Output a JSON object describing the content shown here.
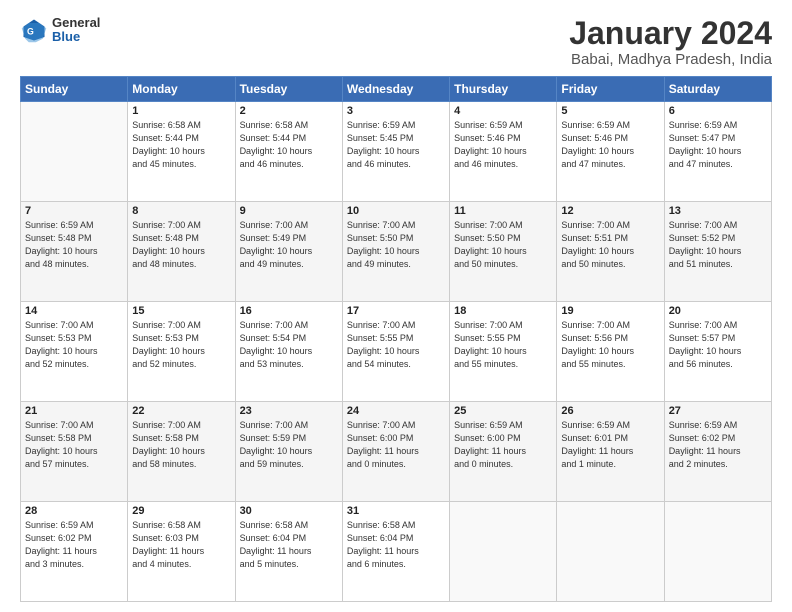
{
  "logo": {
    "general": "General",
    "blue": "Blue"
  },
  "title": "January 2024",
  "subtitle": "Babai, Madhya Pradesh, India",
  "headers": [
    "Sunday",
    "Monday",
    "Tuesday",
    "Wednesday",
    "Thursday",
    "Friday",
    "Saturday"
  ],
  "weeks": [
    [
      {
        "day": "",
        "info": ""
      },
      {
        "day": "1",
        "info": "Sunrise: 6:58 AM\nSunset: 5:44 PM\nDaylight: 10 hours\nand 45 minutes."
      },
      {
        "day": "2",
        "info": "Sunrise: 6:58 AM\nSunset: 5:44 PM\nDaylight: 10 hours\nand 46 minutes."
      },
      {
        "day": "3",
        "info": "Sunrise: 6:59 AM\nSunset: 5:45 PM\nDaylight: 10 hours\nand 46 minutes."
      },
      {
        "day": "4",
        "info": "Sunrise: 6:59 AM\nSunset: 5:46 PM\nDaylight: 10 hours\nand 46 minutes."
      },
      {
        "day": "5",
        "info": "Sunrise: 6:59 AM\nSunset: 5:46 PM\nDaylight: 10 hours\nand 47 minutes."
      },
      {
        "day": "6",
        "info": "Sunrise: 6:59 AM\nSunset: 5:47 PM\nDaylight: 10 hours\nand 47 minutes."
      }
    ],
    [
      {
        "day": "7",
        "info": "Sunrise: 6:59 AM\nSunset: 5:48 PM\nDaylight: 10 hours\nand 48 minutes."
      },
      {
        "day": "8",
        "info": "Sunrise: 7:00 AM\nSunset: 5:48 PM\nDaylight: 10 hours\nand 48 minutes."
      },
      {
        "day": "9",
        "info": "Sunrise: 7:00 AM\nSunset: 5:49 PM\nDaylight: 10 hours\nand 49 minutes."
      },
      {
        "day": "10",
        "info": "Sunrise: 7:00 AM\nSunset: 5:50 PM\nDaylight: 10 hours\nand 49 minutes."
      },
      {
        "day": "11",
        "info": "Sunrise: 7:00 AM\nSunset: 5:50 PM\nDaylight: 10 hours\nand 50 minutes."
      },
      {
        "day": "12",
        "info": "Sunrise: 7:00 AM\nSunset: 5:51 PM\nDaylight: 10 hours\nand 50 minutes."
      },
      {
        "day": "13",
        "info": "Sunrise: 7:00 AM\nSunset: 5:52 PM\nDaylight: 10 hours\nand 51 minutes."
      }
    ],
    [
      {
        "day": "14",
        "info": "Sunrise: 7:00 AM\nSunset: 5:53 PM\nDaylight: 10 hours\nand 52 minutes."
      },
      {
        "day": "15",
        "info": "Sunrise: 7:00 AM\nSunset: 5:53 PM\nDaylight: 10 hours\nand 52 minutes."
      },
      {
        "day": "16",
        "info": "Sunrise: 7:00 AM\nSunset: 5:54 PM\nDaylight: 10 hours\nand 53 minutes."
      },
      {
        "day": "17",
        "info": "Sunrise: 7:00 AM\nSunset: 5:55 PM\nDaylight: 10 hours\nand 54 minutes."
      },
      {
        "day": "18",
        "info": "Sunrise: 7:00 AM\nSunset: 5:55 PM\nDaylight: 10 hours\nand 55 minutes."
      },
      {
        "day": "19",
        "info": "Sunrise: 7:00 AM\nSunset: 5:56 PM\nDaylight: 10 hours\nand 55 minutes."
      },
      {
        "day": "20",
        "info": "Sunrise: 7:00 AM\nSunset: 5:57 PM\nDaylight: 10 hours\nand 56 minutes."
      }
    ],
    [
      {
        "day": "21",
        "info": "Sunrise: 7:00 AM\nSunset: 5:58 PM\nDaylight: 10 hours\nand 57 minutes."
      },
      {
        "day": "22",
        "info": "Sunrise: 7:00 AM\nSunset: 5:58 PM\nDaylight: 10 hours\nand 58 minutes."
      },
      {
        "day": "23",
        "info": "Sunrise: 7:00 AM\nSunset: 5:59 PM\nDaylight: 10 hours\nand 59 minutes."
      },
      {
        "day": "24",
        "info": "Sunrise: 7:00 AM\nSunset: 6:00 PM\nDaylight: 11 hours\nand 0 minutes."
      },
      {
        "day": "25",
        "info": "Sunrise: 6:59 AM\nSunset: 6:00 PM\nDaylight: 11 hours\nand 0 minutes."
      },
      {
        "day": "26",
        "info": "Sunrise: 6:59 AM\nSunset: 6:01 PM\nDaylight: 11 hours\nand 1 minute."
      },
      {
        "day": "27",
        "info": "Sunrise: 6:59 AM\nSunset: 6:02 PM\nDaylight: 11 hours\nand 2 minutes."
      }
    ],
    [
      {
        "day": "28",
        "info": "Sunrise: 6:59 AM\nSunset: 6:02 PM\nDaylight: 11 hours\nand 3 minutes."
      },
      {
        "day": "29",
        "info": "Sunrise: 6:58 AM\nSunset: 6:03 PM\nDaylight: 11 hours\nand 4 minutes."
      },
      {
        "day": "30",
        "info": "Sunrise: 6:58 AM\nSunset: 6:04 PM\nDaylight: 11 hours\nand 5 minutes."
      },
      {
        "day": "31",
        "info": "Sunrise: 6:58 AM\nSunset: 6:04 PM\nDaylight: 11 hours\nand 6 minutes."
      },
      {
        "day": "",
        "info": ""
      },
      {
        "day": "",
        "info": ""
      },
      {
        "day": "",
        "info": ""
      }
    ]
  ]
}
